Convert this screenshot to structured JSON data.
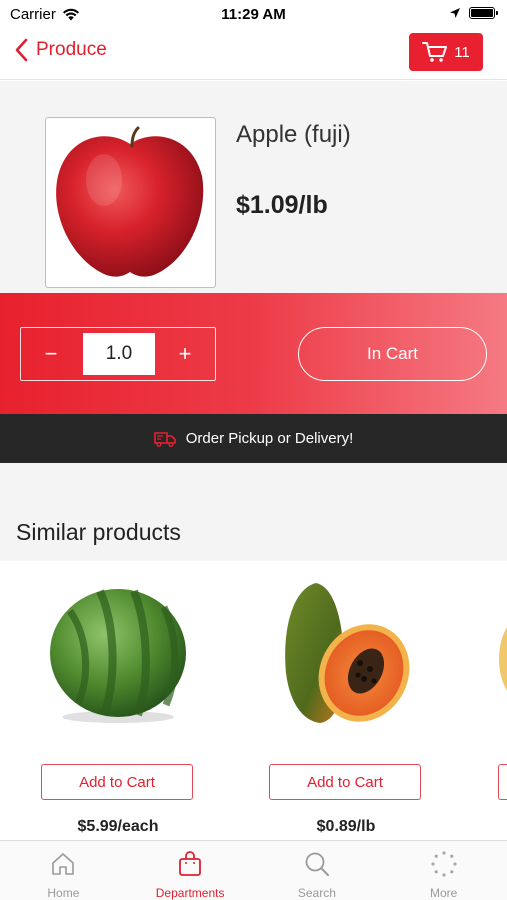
{
  "status_bar": {
    "carrier": "Carrier",
    "time": "11:29 AM",
    "icons": [
      "wifi-icon",
      "location-arrow-icon",
      "battery-icon"
    ]
  },
  "nav": {
    "back_label": "Produce",
    "back_icon": "chevron-left-icon",
    "cart_icon": "shopping-cart-icon",
    "cart_count": "11"
  },
  "product": {
    "name": "Apple (fuji)",
    "price": "$1.09/lb",
    "image": "apple-image"
  },
  "quantity": {
    "minus_label": "−",
    "value": "1.0",
    "plus_label": "+"
  },
  "in_cart_label": "In Cart",
  "promo": {
    "icon": "delivery-truck-icon",
    "text": "Order Pickup or Delivery!"
  },
  "similar": {
    "title": "Similar products",
    "items": [
      {
        "image": "watermelon-image",
        "button_label": "Add to Cart",
        "price": "$5.99/each"
      },
      {
        "image": "papaya-image",
        "button_label": "Add to Cart",
        "price": "$0.89/lb"
      }
    ]
  },
  "tabs": [
    {
      "label": "Home",
      "icon": "home-icon",
      "active": false
    },
    {
      "label": "Departments",
      "icon": "shopping-bag-icon",
      "active": true
    },
    {
      "label": "Search",
      "icon": "search-icon",
      "active": false
    },
    {
      "label": "More",
      "icon": "more-dots-icon",
      "active": false
    }
  ],
  "colors": {
    "accent": "#e8202f",
    "dark_band": "#272727",
    "background": "#f4f4f4"
  }
}
